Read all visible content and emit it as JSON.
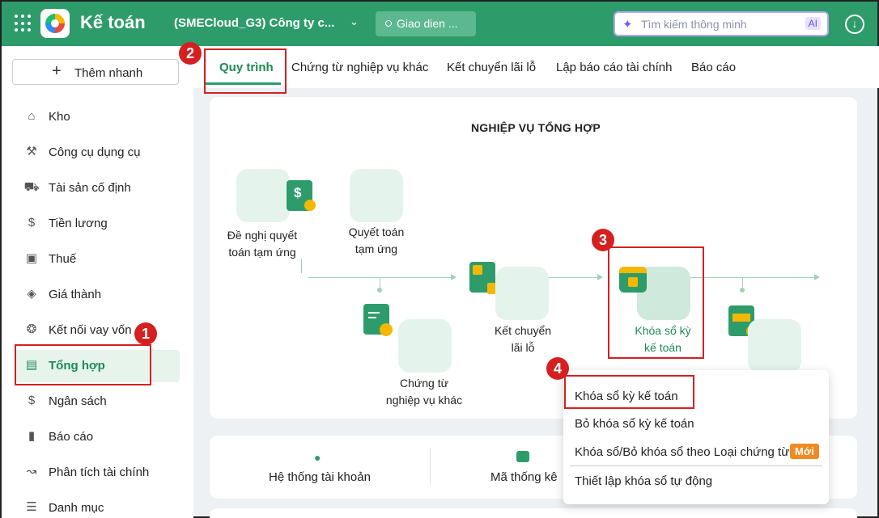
{
  "header": {
    "app_title": "Kế toán",
    "company": "(SMECloud_G3) Công ty c...",
    "ui_button": "Giao dien ...",
    "search_placeholder": "Tìm kiếm thông minh",
    "ai_badge": "AI",
    "colors": {
      "brand": "#2e9c6a",
      "accent": "#1e8a55"
    }
  },
  "sidebar": {
    "quick_add": "Thêm nhanh",
    "items": [
      {
        "label": "Kho",
        "icon": "warehouse-icon"
      },
      {
        "label": "Công cụ dụng cụ",
        "icon": "tools-icon"
      },
      {
        "label": "Tài sản cố định",
        "icon": "car-icon"
      },
      {
        "label": "Tiền lương",
        "icon": "dollar-circle-icon"
      },
      {
        "label": "Thuế",
        "icon": "tax-document-icon"
      },
      {
        "label": "Giá thành",
        "icon": "price-tag-icon"
      },
      {
        "label": "Kết nối vay vốn",
        "icon": "loan-icon"
      },
      {
        "label": "Tổng hợp",
        "icon": "book-icon",
        "active": true
      },
      {
        "label": "Ngân sách",
        "icon": "budget-icon"
      },
      {
        "label": "Báo cáo",
        "icon": "bar-chart-icon"
      },
      {
        "label": "Phân tích tài chính",
        "icon": "analytics-icon"
      },
      {
        "label": "Danh mục",
        "icon": "list-icon"
      }
    ]
  },
  "tabs": [
    {
      "label": "Quy trình",
      "active": true
    },
    {
      "label": "Chứng từ nghiệp vụ khác"
    },
    {
      "label": "Kết chuyển lãi lỗ"
    },
    {
      "label": "Lập báo cáo tài chính"
    },
    {
      "label": "Báo cáo"
    }
  ],
  "process": {
    "title": "NGHIỆP VỤ TỔNG HỢP",
    "nodes": {
      "advance_request": [
        "Đề nghị quyết",
        "toán tạm ứng"
      ],
      "advance_settlement": [
        "Quyết toán",
        "tạm ứng"
      ],
      "other_vouchers": [
        "Chứng từ",
        "nghiệp vụ khác"
      ],
      "profit_loss": [
        "Kết chuyển",
        "lãi lỗ"
      ],
      "lock_period": [
        "Khóa sổ kỳ",
        "kế toán"
      ]
    }
  },
  "bottom": {
    "accounts": "Hệ thống tài khoản",
    "stats_code": "Mã thống kê"
  },
  "dropdown": {
    "items": [
      "Khóa sổ kỳ kế toán",
      "Bỏ khóa sổ kỳ kế toán",
      "Khóa sổ/Bỏ khóa sổ theo Loại chứng từ",
      "Thiết lập khóa sổ tự động"
    ],
    "new_badge": "Mới"
  },
  "annotations": [
    "1",
    "2",
    "3",
    "4"
  ]
}
